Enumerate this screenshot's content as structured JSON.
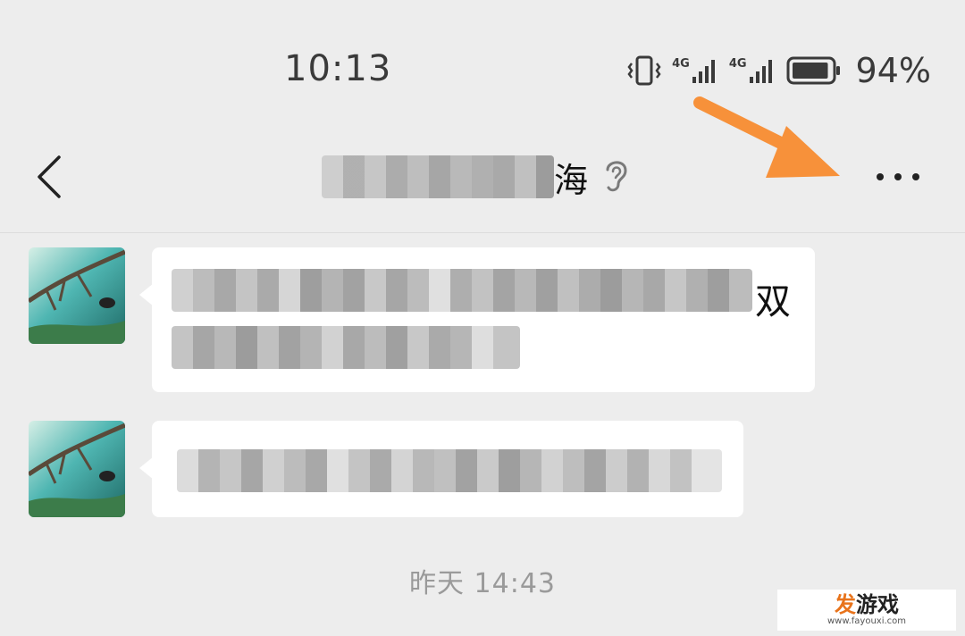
{
  "status_bar": {
    "time": "10:13",
    "network_1": "4G",
    "network_2": "4G",
    "battery_percent": "94%",
    "battery_level": 0.94,
    "icons": [
      "vibrate-icon",
      "signal-icon",
      "signal-icon",
      "battery-icon"
    ]
  },
  "nav": {
    "back_icon": "chevron-left-icon",
    "title_visible_suffix": "海",
    "ear_icon": "ear-icon",
    "more_icon": "more-horizontal-icon"
  },
  "annotation": {
    "arrow_color": "#f7913a"
  },
  "messages": [
    {
      "visible_tail_char": "双"
    },
    {
      "visible_tail_char": ""
    }
  ],
  "timestamp": "昨天 14:43",
  "watermark": {
    "accent": "发",
    "main": "游戏",
    "sub": "www.fayouxi.com"
  },
  "colors": {
    "background": "#ededed",
    "bubble": "#ffffff",
    "arrow": "#f7913a",
    "text": "#111111",
    "muted": "#9a9a9a"
  }
}
